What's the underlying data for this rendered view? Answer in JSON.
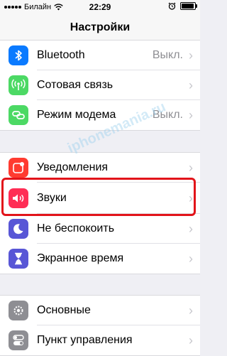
{
  "status_bar": {
    "carrier": "Билайн",
    "time": "22:29",
    "battery_level": 0.95
  },
  "nav": {
    "title": "Настройки"
  },
  "groups": [
    {
      "items": [
        {
          "label": "Bluetooth",
          "value": "Выкл.",
          "icon": "bluetooth-icon",
          "color": "#0a7aff"
        },
        {
          "label": "Сотовая связь",
          "value": "",
          "icon": "cellular-antenna-icon",
          "color": "#4cd964"
        },
        {
          "label": "Режим модема",
          "value": "Выкл.",
          "icon": "hotspot-chain-icon",
          "color": "#4cd964"
        }
      ]
    },
    {
      "items": [
        {
          "label": "Уведомления",
          "value": "",
          "icon": "notifications-icon",
          "color": "#ff3b30"
        },
        {
          "label": "Звуки",
          "value": "",
          "icon": "speaker-icon",
          "color": "#ff2d55"
        },
        {
          "label": "Не беспокоить",
          "value": "",
          "icon": "moon-icon",
          "color": "#5856d6"
        },
        {
          "label": "Экранное время",
          "value": "",
          "icon": "hourglass-icon",
          "color": "#5856d6"
        }
      ]
    },
    {
      "items": [
        {
          "label": "Основные",
          "value": "",
          "icon": "gear-icon",
          "color": "#8e8e93"
        },
        {
          "label": "Пункт управления",
          "value": "",
          "icon": "toggles-icon",
          "color": "#8e8e93"
        }
      ]
    }
  ],
  "watermark": "iphonemania.ru",
  "colors": {
    "highlight": "#e2141a",
    "background": "#efeff4"
  }
}
